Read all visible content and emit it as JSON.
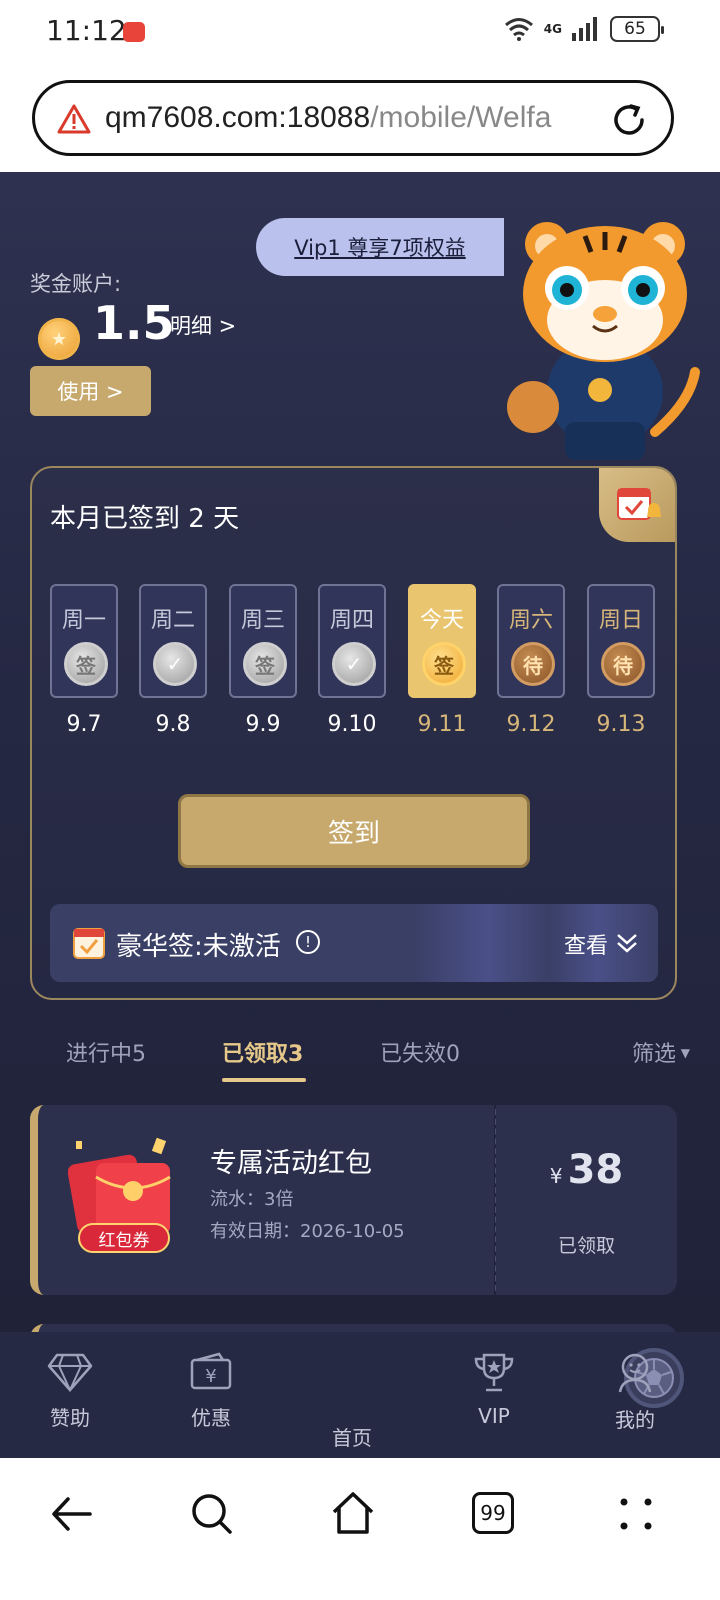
{
  "status_bar": {
    "time": "11:12",
    "network": "4G",
    "battery": "65"
  },
  "browser": {
    "url_host": "qm7608.com:18088",
    "url_path": "/mobile/Welfa"
  },
  "header": {
    "vip_banner": "Vip1 尊享7项权益",
    "bonus_label": "奖金账户:",
    "bonus_amount": "1.5",
    "detail_link": "明细 >",
    "use_button": "使用 >"
  },
  "signin": {
    "title": "本月已签到 2 天",
    "days": [
      {
        "label": "周一",
        "date": "9.7",
        "state": "sign",
        "icon_text": "签"
      },
      {
        "label": "周二",
        "date": "9.8",
        "state": "check",
        "icon_text": "✓"
      },
      {
        "label": "周三",
        "date": "9.9",
        "state": "sign",
        "icon_text": "签"
      },
      {
        "label": "周四",
        "date": "9.10",
        "state": "check",
        "icon_text": "✓"
      },
      {
        "label": "今天",
        "date": "9.11",
        "state": "today",
        "icon_text": "签"
      },
      {
        "label": "周六",
        "date": "9.12",
        "state": "wait",
        "icon_text": "待"
      },
      {
        "label": "周日",
        "date": "9.13",
        "state": "wait",
        "icon_text": "待"
      }
    ],
    "sign_button": "签到",
    "luxury_text": "豪华签:未激活",
    "luxury_view": "查看"
  },
  "tabs": {
    "items": [
      "进行中5",
      "已领取3",
      "已失效0"
    ],
    "active": "已领取3",
    "filter": "筛选"
  },
  "coupon": {
    "badge": "红包券",
    "title": "专属活动红包",
    "flow": "流水：3倍",
    "valid_date": "有效日期：2026-10-05",
    "currency": "¥",
    "amount": "38",
    "status": "已领取"
  },
  "app_nav": {
    "items": [
      {
        "label": "赞助",
        "icon": "diamond-icon"
      },
      {
        "label": "优惠",
        "icon": "coupon-icon"
      },
      {
        "label": "首页",
        "icon": "soccer-ball-icon"
      },
      {
        "label": "VIP",
        "icon": "trophy-icon"
      },
      {
        "label": "我的",
        "icon": "person-icon"
      }
    ]
  },
  "system_nav": {
    "tabs_count": "99"
  },
  "colors": {
    "gold": "#c7a96e",
    "panel": "#2c304d",
    "background": "#252843"
  }
}
